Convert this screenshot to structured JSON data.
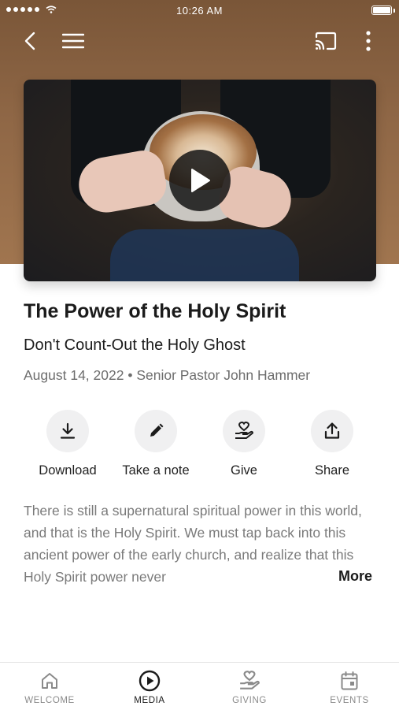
{
  "status_bar": {
    "time": "10:26 AM"
  },
  "header": {
    "back_icon": "chevron-left-icon",
    "menu_icon": "hamburger-menu-icon",
    "cast_icon": "cast-icon",
    "more_icon": "vertical-dots-icon"
  },
  "video": {
    "play_icon": "play-icon"
  },
  "sermon": {
    "title": "The Power of the Holy Spirit",
    "subtitle": "Don't Count-Out the Holy Ghost",
    "meta": "August 14, 2022 • Senior Pastor John Hammer"
  },
  "actions": [
    {
      "label": "Download",
      "icon": "download-icon"
    },
    {
      "label": "Take a note",
      "icon": "pencil-icon"
    },
    {
      "label": "Give",
      "icon": "giving-hand-heart-icon"
    },
    {
      "label": "Share",
      "icon": "share-icon"
    }
  ],
  "description": {
    "text": "There is still a supernatural spiritual power in this world, and that is the Holy Spirit. We must tap back into this ancient power of the early church, and realize that this Holy Spirit power never",
    "more_label": "More"
  },
  "tabs": [
    {
      "label": "WELCOME",
      "icon": "home-icon",
      "active": false
    },
    {
      "label": "MEDIA",
      "icon": "play-circle-icon",
      "active": true
    },
    {
      "label": "GIVING",
      "icon": "giving-hand-heart-icon",
      "active": false
    },
    {
      "label": "EVENTS",
      "icon": "calendar-icon",
      "active": false
    }
  ],
  "colors": {
    "header_bg": "#8f6746",
    "active_tab": "#1b1b1b",
    "inactive_tab": "#8a8a8a",
    "action_circle": "#f0f0f1"
  }
}
